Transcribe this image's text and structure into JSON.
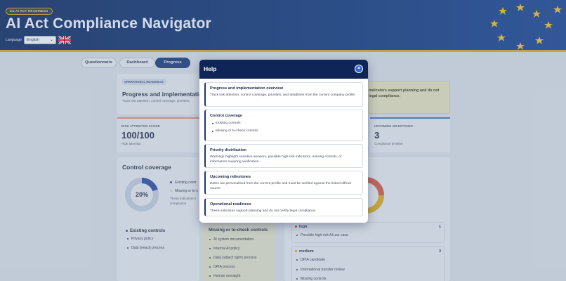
{
  "header": {
    "badge": "EU AI ACT READINESS",
    "title": "AI Act Compliance Navigator",
    "language_label": "Language",
    "language_value": "English"
  },
  "tabs": [
    {
      "label": "Questionnaire",
      "active": false
    },
    {
      "label": "Dashboard",
      "active": false
    },
    {
      "label": "Progress",
      "active": true
    }
  ],
  "background": {
    "pill": "OPERATIONAL READINESS",
    "overview_title": "Progress and implementation o",
    "overview_sub": "Track risk attention, control coverage, priorities,",
    "notice_text": "indicators support planning and do not legal compliance.",
    "stats": [
      {
        "label": "RISK ATTENTION SCORE",
        "value": "100/100",
        "sub": "High attention"
      },
      {
        "label": "UPCOMING MILESTONES",
        "value": "3",
        "sub": "Compliance timeline"
      }
    ],
    "control_coverage_title": "Control coverage",
    "donut_value": "20%",
    "donut_percent": 20,
    "legend_existing": "Existing contr",
    "legend_missing": "Missing or to-c",
    "legend_note_1": "These indicators s",
    "legend_note_2": "compliance.",
    "existing_head": "Existing controls",
    "existing_items": [
      "Privacy policy",
      "Data breach process"
    ],
    "missing_head": "Missing or to-check controls",
    "missing_items": [
      "AI system documentation",
      "Internal AI policy",
      "Data subject rights process",
      "DPIA process",
      "Human oversight"
    ],
    "priority_high_label": "high",
    "priority_high_count": "1",
    "priority_high_items": [
      "Possible high-risk AI use case"
    ],
    "priority_medium_label": "medium",
    "priority_medium_count": "3",
    "priority_medium_items": [
      "DPIA candidate",
      "International transfer review",
      "Missing controls"
    ],
    "colors": {
      "accent": "#1a3a7a",
      "high": "#c0392b",
      "medium": "#c9a227"
    }
  },
  "modal": {
    "title": "Help",
    "close_label": "×",
    "sections": [
      {
        "title": "Progress and implementation overview",
        "body": "Track risk attention, control coverage, priorities, and deadlines from the current company profile."
      },
      {
        "title": "Control coverage",
        "items": [
          "Existing controls",
          "Missing or to-check controls"
        ]
      },
      {
        "title": "Priority distribution",
        "body": "Warnings highlight sensitive answers, possible high-risk indicators, missing controls, or information requiring verification."
      },
      {
        "title": "Upcoming milestones",
        "body": "Dates are personalised from the current profile and must be verified against the linked official source."
      },
      {
        "title": "Operational readiness",
        "body": "These indicators support planning and do not certify legal compliance."
      }
    ]
  }
}
